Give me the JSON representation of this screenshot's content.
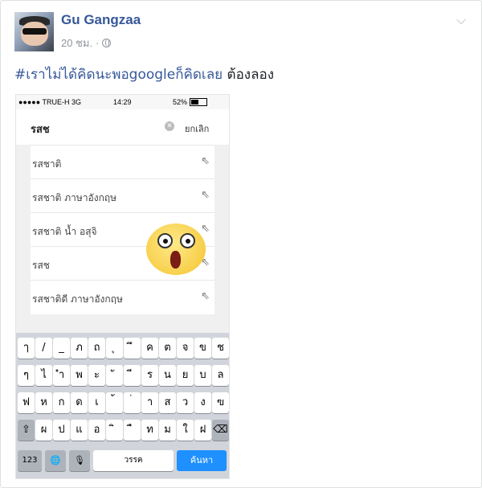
{
  "post": {
    "author": "Gu Gangzaa",
    "time": "20 ชม.",
    "dot": "·",
    "chevron": "⌵",
    "hashtag": "#เราไม่ได้คิดนะพอgoogleก็คิดเลย",
    "text": " ต้องลอง"
  },
  "phone": {
    "carrier": "●●●●● TRUE-H  3G",
    "time": "14:29",
    "battery": "52%",
    "search_query": "รสช",
    "clear_glyph": "✕",
    "cancel_label": "ยกเลิก",
    "arrow_glyph": "⇖",
    "suggestions": [
      "รสชาติ",
      "รสชาติ ภาษาอังกฤษ",
      "รสชาติ น้ำ อสุจิ",
      "รสช",
      "รสชาติดี ภาษาอังกฤษ"
    ],
    "keyboard": {
      "row1": [
        "ๅ",
        "/",
        "_",
        "ภ",
        "ถ",
        "ุ",
        "ึ",
        "ค",
        "ต",
        "จ",
        "ข",
        "ช"
      ],
      "row2": [
        "ๆ",
        "ไ",
        "ำ",
        "พ",
        "ะ",
        "ั",
        "ี",
        "ร",
        "น",
        "ย",
        "บ",
        "ล"
      ],
      "row3": [
        "ฟ",
        "ห",
        "ก",
        "ด",
        "เ",
        "้",
        "่",
        "า",
        "ส",
        "ว",
        "ง",
        "ฃ"
      ],
      "row4": [
        "⇧",
        "ผ",
        "ป",
        "แ",
        "อ",
        "ิ",
        "ื",
        "ท",
        "ม",
        "ใ",
        "ฝ",
        "⌫"
      ],
      "key_123": "123",
      "globe": "🌐",
      "mic": "🎙",
      "space_label": "วรรค",
      "search_label": "ค้นหา"
    }
  }
}
